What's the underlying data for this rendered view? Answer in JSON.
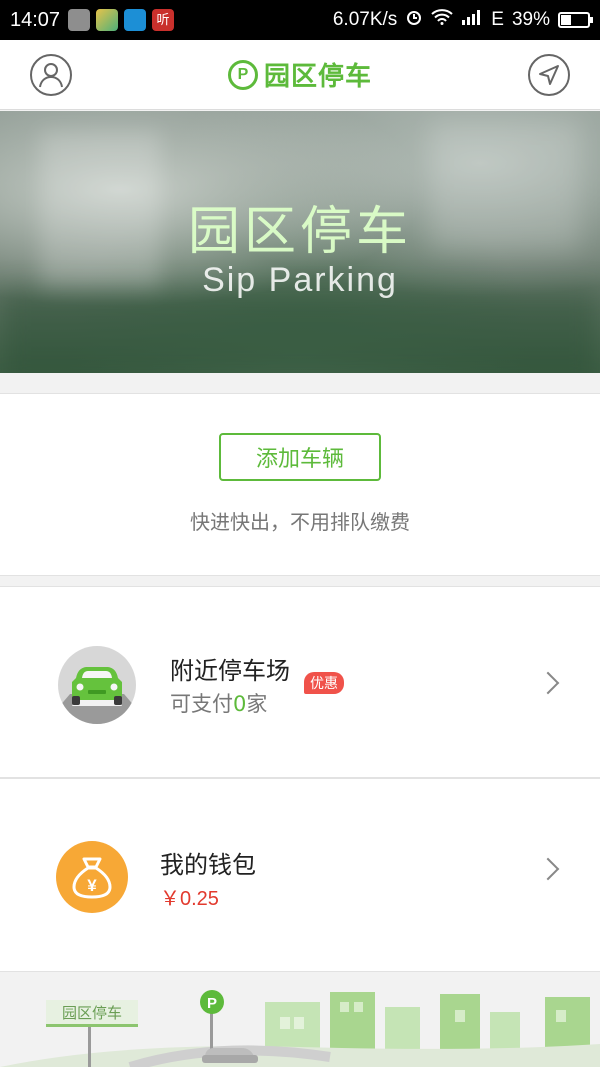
{
  "status_bar": {
    "time": "14:07",
    "speed": "6.07K/s",
    "network": "E",
    "battery": "39%",
    "battery_level": 0.39,
    "notif_label": "听"
  },
  "header": {
    "brand_mark": "P",
    "title": "园区停车",
    "brand_color": "#5dba3b"
  },
  "banner": {
    "title": "园区停车",
    "subtitle": "Sip Parking"
  },
  "add_vehicle": {
    "button_label": "添加车辆",
    "tip": "快进快出，不用排队缴费"
  },
  "nearby": {
    "title": "附近停车场",
    "badge": "优惠",
    "sub_prefix": "可支付",
    "count": "0",
    "sub_suffix": "家"
  },
  "wallet": {
    "icon_glyph": "¥",
    "title": "我的钱包",
    "balance": "￥0.25"
  },
  "footer": {
    "sign": "园区停车",
    "sign_mark": "P"
  }
}
